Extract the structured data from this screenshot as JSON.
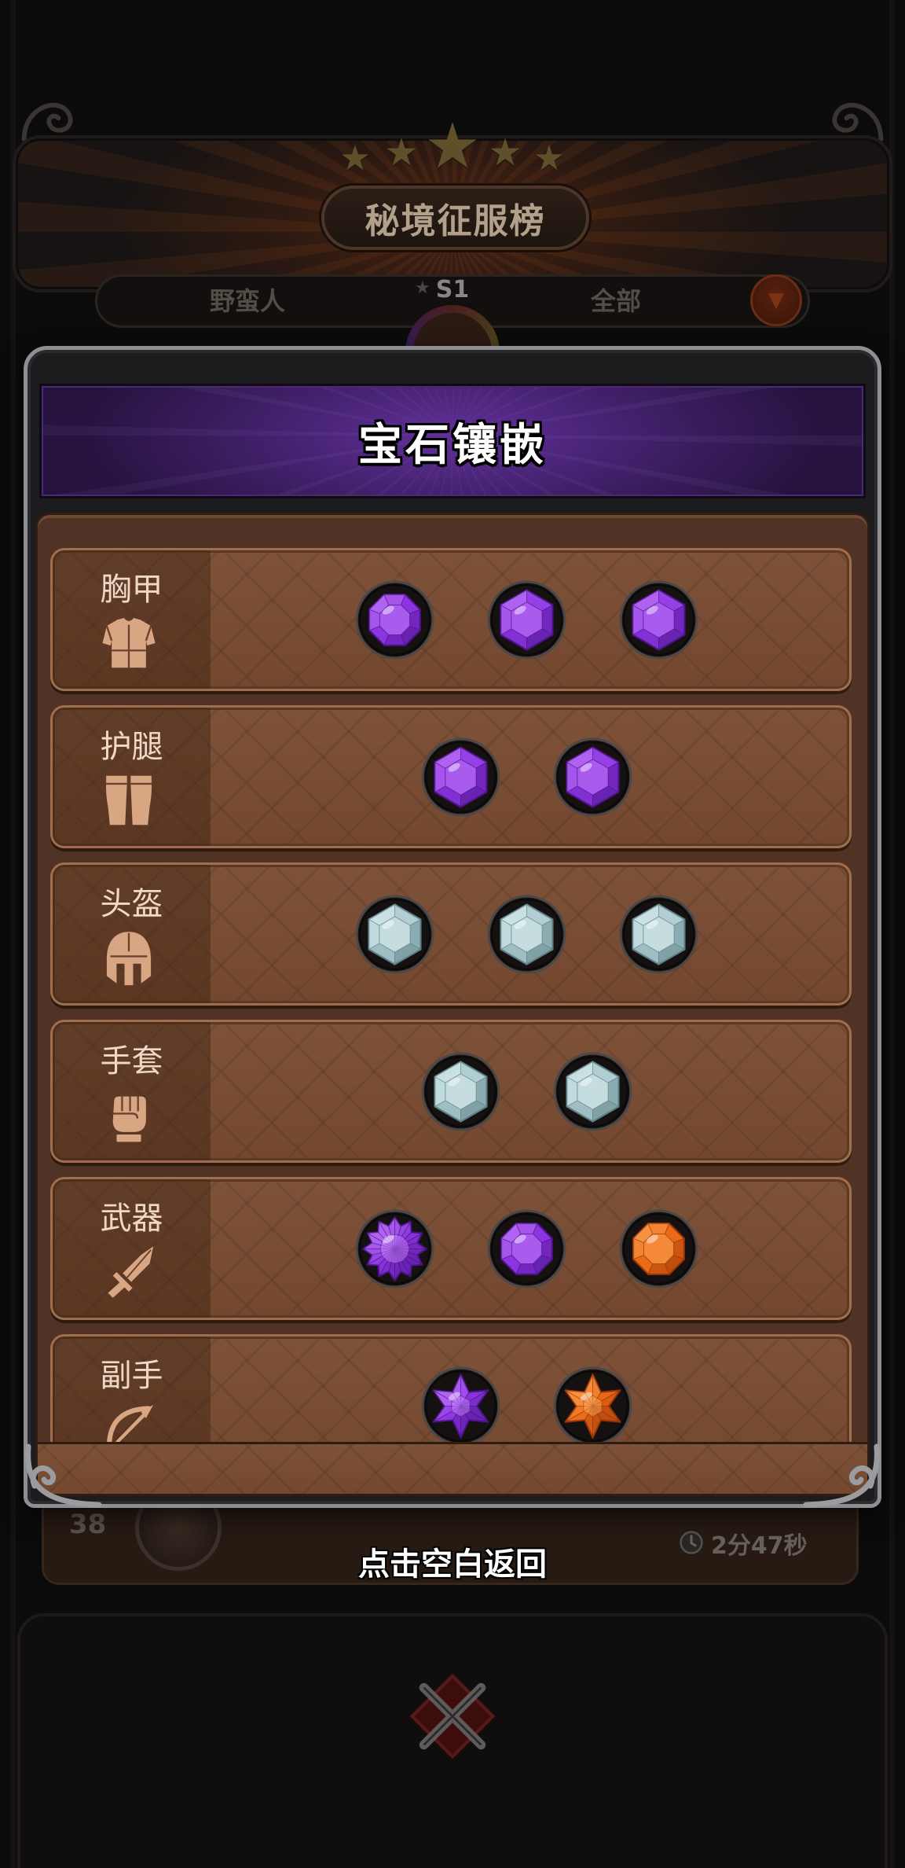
{
  "leaderboard": {
    "title": "秘境征服榜",
    "class_filter": "野蛮人",
    "season": "S1",
    "scope_filter": "全部",
    "entry": {
      "rank": "38",
      "clear_time": "2分47秒"
    }
  },
  "gem_panel": {
    "title": "宝石镶嵌",
    "rows": [
      {
        "label": "胸甲",
        "icon": "chest-armor-icon",
        "gems": [
          "purple-octagon-gem-icon",
          "purple-hexagon-gem-icon",
          "purple-hexagon-gem-icon"
        ]
      },
      {
        "label": "护腿",
        "icon": "leg-armor-icon",
        "gems": [
          "purple-hexagon-gem-icon",
          "purple-hexagon-gem-icon"
        ]
      },
      {
        "label": "头盔",
        "icon": "helmet-icon",
        "gems": [
          "silver-hexagon-gem-icon",
          "silver-hexagon-gem-icon",
          "silver-hexagon-gem-icon"
        ]
      },
      {
        "label": "手套",
        "icon": "gauntlet-icon",
        "gems": [
          "silver-hexagon-gem-icon",
          "silver-hexagon-gem-icon"
        ]
      },
      {
        "label": "武器",
        "icon": "sword-icon",
        "gems": [
          "purple-starburst-gem-icon",
          "purple-octagon-gem-icon",
          "orange-octagon-gem-icon"
        ]
      },
      {
        "label": "副手",
        "icon": "bow-icon",
        "gems": [
          "purple-star-gem-icon",
          "orange-star-gem-icon"
        ]
      }
    ]
  },
  "footer": {
    "dismiss_hint": "点击空白返回"
  },
  "palette": {
    "purple": {
      "base": "#8b34e0",
      "light": "#cf8bff",
      "dark": "#4c1489"
    },
    "silver": {
      "base": "#a9c9cd",
      "light": "#e6f6f7",
      "dark": "#5d7f85"
    },
    "orange": {
      "base": "#ea6a18",
      "light": "#ffb061",
      "dark": "#9a3506"
    }
  }
}
